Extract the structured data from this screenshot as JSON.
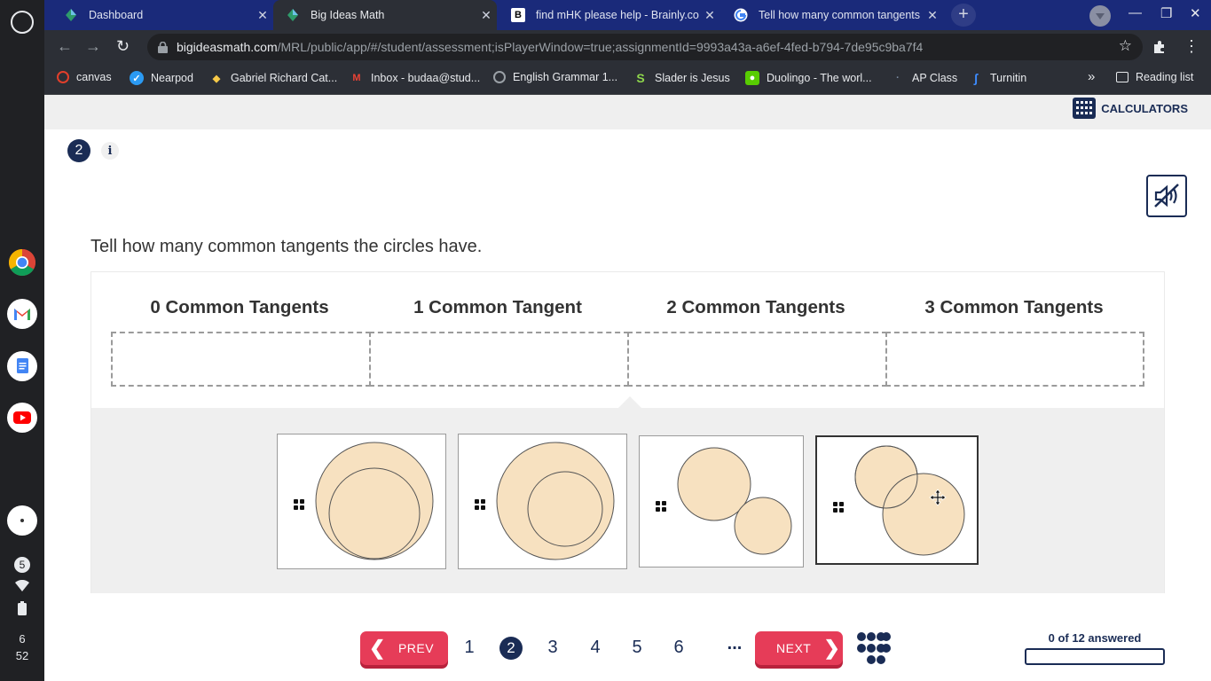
{
  "browser": {
    "tabs": [
      {
        "title": "Dashboard",
        "active": false
      },
      {
        "title": "Big Ideas Math",
        "active": true
      },
      {
        "title": "find mHK please help - Brainly.com",
        "active": false
      },
      {
        "title": "Tell how many common tangents",
        "active": false
      }
    ],
    "url_host": "bigideasmath.com",
    "url_path": "/MRL/public/app/#/student/assessment;isPlayerWindow=true;assignmentId=9993a43a-a6ef-4fed-b794-7de95c9ba7f4",
    "bookmarks": [
      "canvas",
      "Nearpod",
      "Gabriel Richard Cat...",
      "Inbox - budaa@stud...",
      "English Grammar 1...",
      "Slader is Jesus",
      "Duolingo - The worl...",
      "AP Class",
      "Turnitin"
    ],
    "overflow": "»",
    "reading_list": "Reading list"
  },
  "shelf": {
    "notification_count": "5",
    "time_hour": "6",
    "time_min": "52"
  },
  "page": {
    "calculators_label": "CALCULATORS",
    "question_number": "2",
    "info_label": "i",
    "prompt": "Tell how many common tangents the circles have.",
    "columns": [
      "0 Common Tangents",
      "1 Common Tangent",
      "2 Common Tangents",
      "3 Common Tangents"
    ],
    "cards": [
      "internally-tangent-circles",
      "nested-circles",
      "separate-circles",
      "intersecting-circles"
    ],
    "selected_card": 3
  },
  "pagination": {
    "prev_label": "PREV",
    "next_label": "NEXT",
    "pages": [
      "1",
      "2",
      "3",
      "4",
      "5",
      "6"
    ],
    "current_page": "2",
    "ellipsis": "...",
    "answered_label": "0 of 12 answered",
    "answered": 0,
    "total": 12
  },
  "colors": {
    "navy": "#1a2c55",
    "accent_red": "#e63c58",
    "circle_fill": "#f7e1c0",
    "bank_bg": "#efefef"
  }
}
